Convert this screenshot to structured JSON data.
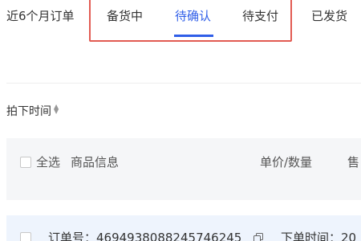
{
  "tabs": [
    {
      "label": "近6个月订单",
      "active": false
    },
    {
      "label": "备货中",
      "active": false
    },
    {
      "label": "待确认",
      "active": true
    },
    {
      "label": "待支付",
      "active": false
    },
    {
      "label": "已发货",
      "active": false
    }
  ],
  "sort": {
    "label": "拍下时间"
  },
  "table_header": {
    "select_all": "全选",
    "product_info": "商品信息",
    "price_qty": "单价/数量",
    "after_sale": "售"
  },
  "order": {
    "order_no": "订单号：4694938088245746245",
    "order_time": "下单时间：20"
  },
  "colors": {
    "accent": "#2f5ee8",
    "highlight": "#e25b52",
    "header_bg": "#f5f6f8",
    "order_bg": "#eef4fd"
  }
}
